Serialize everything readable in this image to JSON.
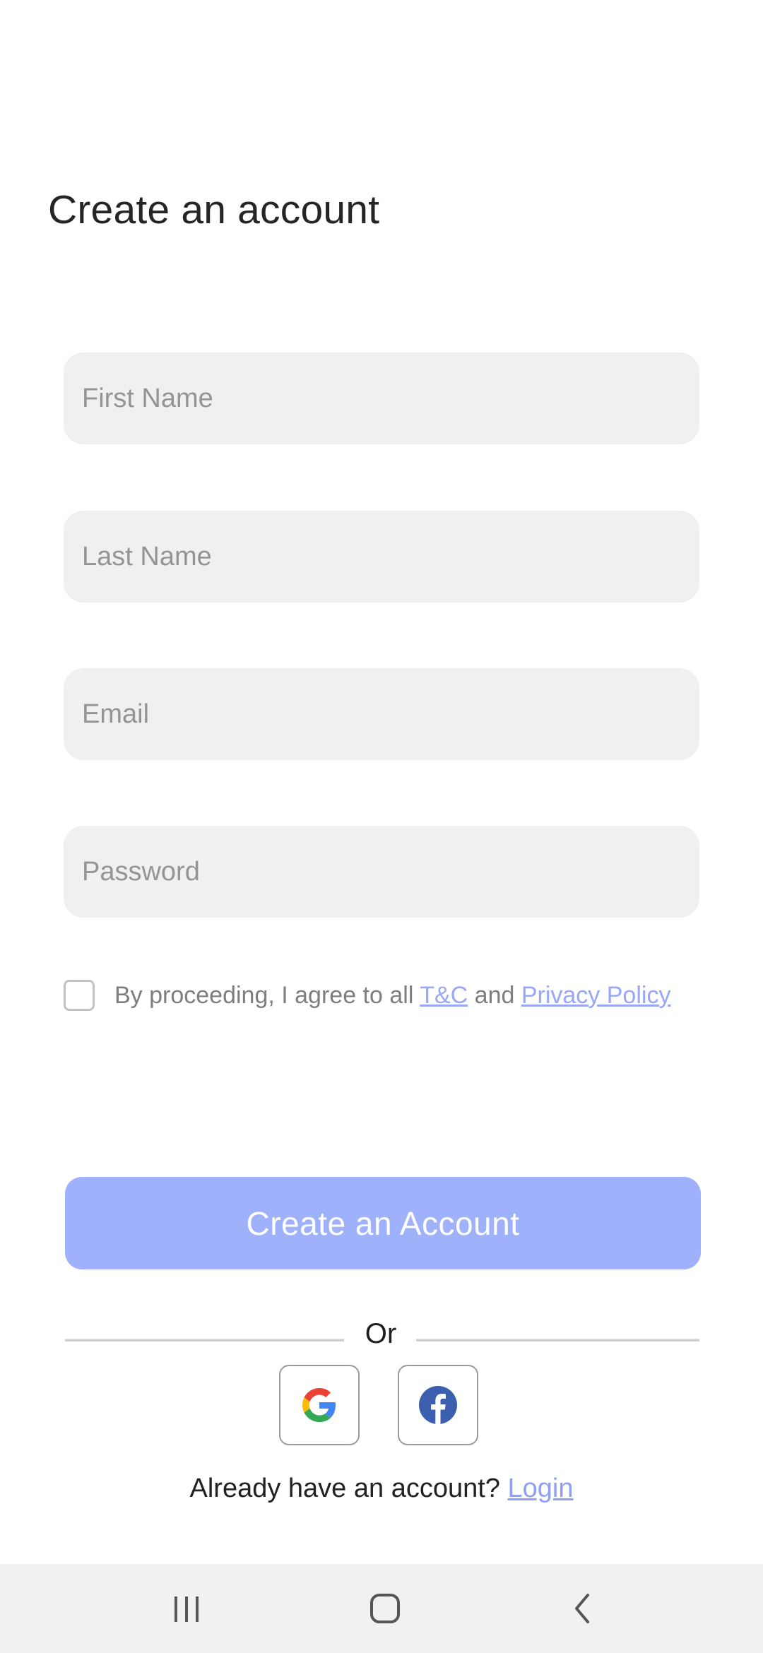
{
  "title": "Create an account",
  "form": {
    "first_name": {
      "placeholder": "First Name",
      "value": ""
    },
    "last_name": {
      "placeholder": "Last Name",
      "value": ""
    },
    "email": {
      "placeholder": "Email",
      "value": ""
    },
    "password": {
      "placeholder": "Password",
      "value": ""
    }
  },
  "consent": {
    "checked": false,
    "prefix": "By proceeding, I agree to all ",
    "terms_link": "T&C",
    "middle": " and ",
    "privacy_link": "Privacy Policy"
  },
  "primary_button": {
    "label": "Create an Account"
  },
  "divider": {
    "text": "Or"
  },
  "social": {
    "google": {
      "icon": "google-icon"
    },
    "facebook": {
      "icon": "facebook-icon"
    }
  },
  "login": {
    "prompt": "Already have an account? ",
    "link": "Login"
  },
  "navbar": {
    "recents_icon": "recents-icon",
    "home_icon": "home-icon",
    "back_icon": "back-icon"
  },
  "colors": {
    "accent": "#9fb1fb",
    "link": "#9aa7f6",
    "field_bg": "#f0f0f0",
    "navbar_bg": "#f1f1f1"
  }
}
